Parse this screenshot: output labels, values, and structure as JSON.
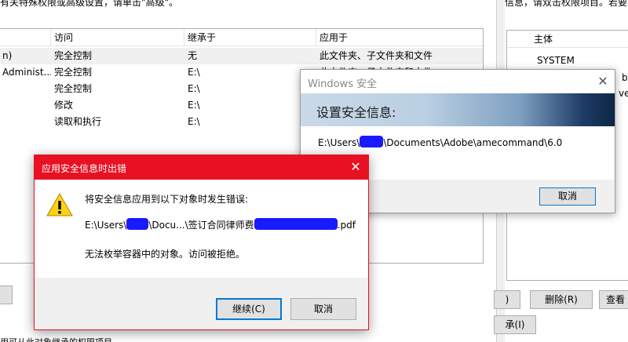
{
  "bg_left": {
    "top_text": "有关特殊权限或高级设置，请单击\"高级\"。",
    "columns": [
      "",
      "访问",
      "继承于",
      "应用于"
    ],
    "rows": [
      {
        "principal": "n)",
        "access": "完全控制",
        "inherited": "无",
        "applies": "此文件夹、子文件夹和文件"
      },
      {
        "principal": "Administ...",
        "access": "完全控制",
        "inherited": "E:\\",
        "applies": "此文件夹、子文件夹和文件"
      },
      {
        "principal": "",
        "access": "完全控制",
        "inherited": "E:\\",
        "applies": ""
      },
      {
        "principal": "",
        "access": "修改",
        "inherited": "E:\\",
        "applies": ""
      },
      {
        "principal": "",
        "access": "读取和执行",
        "inherited": "E:\\",
        "applies": ""
      }
    ],
    "bottom_text": "用可从此对象继承的权限项目"
  },
  "bg_right": {
    "top_text": "信息，请双击权限项目。若要",
    "col_header": "主体",
    "rows": [
      "SYSTEM",
      "bb",
      "ve."
    ],
    "buttons": {
      "add": ")",
      "delete": "删除(R)",
      "view": "查看",
      "inherit": "承(I)"
    }
  },
  "sec_dialog": {
    "title": "Windows 安全",
    "close_glyph": "✕",
    "banner": "设置安全信息:",
    "path_prefix": "E:\\Users\\",
    "path_suffix": "\\Documents\\Adobe\\amecommand\\6.0",
    "cancel": "取消"
  },
  "err_dialog": {
    "title": "应用安全信息时出错",
    "close_glyph": "✕",
    "message": "将安全信息应用到以下对象时发生错误:",
    "path_prefix": "E:\\Users\\",
    "path_mid": "\\Docu...\\签订合同律师费",
    "path_suffix": ".pdf",
    "detail": "无法枚举容器中的对象。访问被拒绝。",
    "continue": "继续(C)",
    "cancel": "取消"
  },
  "colors": {
    "error_titlebar": "#e81123",
    "accent_blue": "#0078d7",
    "redaction": "#1a1aff",
    "warning_yellow": "#fcd116"
  }
}
